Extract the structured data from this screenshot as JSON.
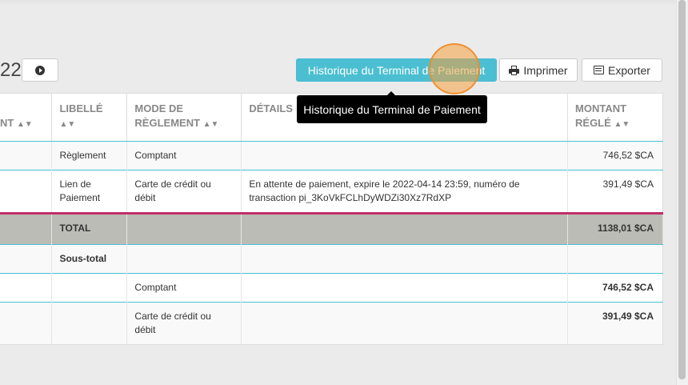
{
  "header": {
    "year_fragment": "22",
    "buttons": {
      "history": "Historique du Terminal de Paiement",
      "print": "Imprimer",
      "export": "Exporter"
    },
    "tooltip": "Historique du Terminal de Paiement"
  },
  "table": {
    "columns": {
      "col0": "NT",
      "label": "LIBELLÉ",
      "method_line1": "MODE DE",
      "method_line2": "RÈGLEMENT",
      "details": "DÉTAILS",
      "amount_line1": "MONTANT",
      "amount_line2": "RÉGLÉ"
    },
    "rows": [
      {
        "label": "Règlement",
        "method": "Comptant",
        "details": "",
        "amount": "746,52 $CA"
      },
      {
        "label": "Lien de Paiement",
        "method": "Carte de crédit ou débit",
        "details": "En attente de paiement, expire le 2022-04-14 23:59, numéro de transaction pi_3KoVkFCLhDyWDZi30Xz7RdXP",
        "amount": "391,49 $CA"
      }
    ],
    "total": {
      "label": "TOTAL",
      "amount": "1138,01 $CA"
    },
    "subtotal": {
      "label": "Sous-total",
      "rows": [
        {
          "method": "Comptant",
          "amount": "746,52 $CA"
        },
        {
          "method": "Carte de crédit ou débit",
          "amount": "391,49 $CA"
        }
      ]
    }
  },
  "colors": {
    "primary": "#4bbfd1",
    "total_bg": "#bcbcb6",
    "total_border": "#c0306a",
    "click_ring": "#f5a03c"
  },
  "icons": {
    "nav": "play-circle-icon",
    "print": "printer-icon",
    "export": "list-icon",
    "sort": "sort-icon"
  }
}
